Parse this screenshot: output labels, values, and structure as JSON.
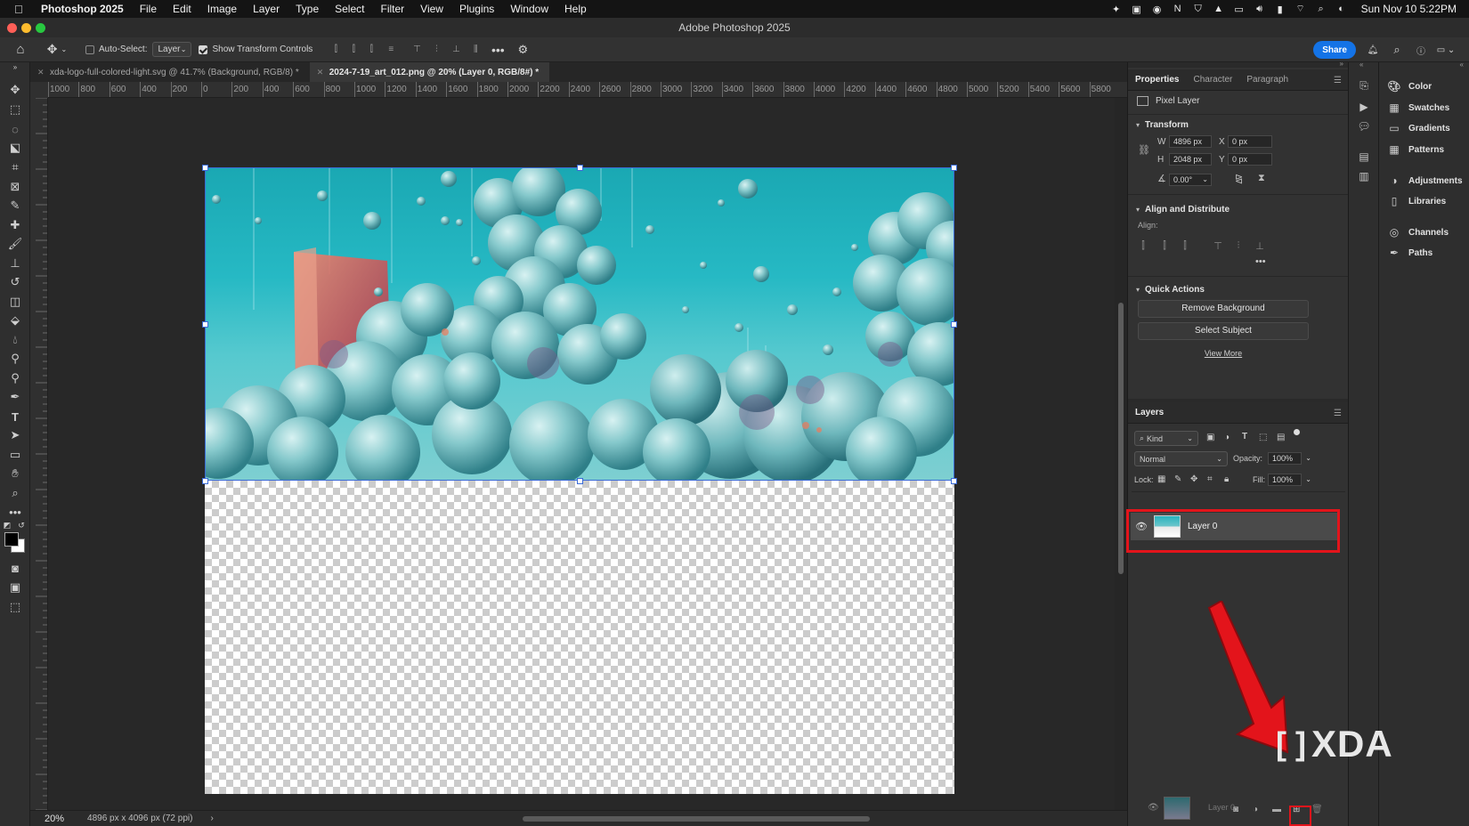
{
  "menubar": {
    "app_name": "Photoshop 2025",
    "menus": [
      "File",
      "Edit",
      "Image",
      "Layer",
      "Type",
      "Select",
      "Filter",
      "View",
      "Plugins",
      "Window",
      "Help"
    ],
    "clock": "Sun Nov 10  5:22PM"
  },
  "window": {
    "title": "Adobe Photoshop 2025"
  },
  "options_bar": {
    "auto_select_label": "Auto-Select:",
    "auto_select_value": "Layer",
    "show_transform_label": "Show Transform Controls",
    "share_label": "Share"
  },
  "tabs": [
    {
      "label": "xda-logo-full-colored-light.svg @ 41.7% (Background, RGB/8) *",
      "active": false
    },
    {
      "label": "2024-7-19_art_012.png @ 20% (Layer 0, RGB/8#) *",
      "active": true
    }
  ],
  "ruler": {
    "h_labels": [
      "1000",
      "800",
      "600",
      "400",
      "200",
      "0",
      "200",
      "400",
      "600",
      "800",
      "1000",
      "1200",
      "1400",
      "1600",
      "1800",
      "2000",
      "2200",
      "2400",
      "2600",
      "2800",
      "3000",
      "3200",
      "3400",
      "3600",
      "3800",
      "4000",
      "4200",
      "4400",
      "4600",
      "4800",
      "5000",
      "5200",
      "5400",
      "5600",
      "5800"
    ]
  },
  "status_bar": {
    "zoom": "20%",
    "doc_info": "4896 px x 4096 px (72 ppi)"
  },
  "properties": {
    "tabs": [
      "Properties",
      "Character",
      "Paragraph"
    ],
    "layer_kind": "Pixel Layer",
    "transform_title": "Transform",
    "w_label": "W",
    "w_value": "4896 px",
    "h_label": "H",
    "h_value": "2048 px",
    "x_label": "X",
    "x_value": "0 px",
    "y_label": "Y",
    "y_value": "0 px",
    "angle_value": "0.00°",
    "align_title": "Align and Distribute",
    "align_label": "Align:",
    "quick_actions_title": "Quick Actions",
    "remove_bg_label": "Remove Background",
    "select_subject_label": "Select Subject",
    "view_more_label": "View More"
  },
  "layers": {
    "title": "Layers",
    "filter_kind": "Kind",
    "blend_mode": "Normal",
    "opacity_label": "Opacity:",
    "opacity_value": "100%",
    "lock_label": "Lock:",
    "fill_label": "Fill:",
    "fill_value": "100%",
    "layer_name": "Layer 0",
    "ghost_layer_name": "Layer 0"
  },
  "right_panel_items": [
    "Color",
    "Swatches",
    "Gradients",
    "Patterns",
    "Adjustments",
    "Libraries",
    "Channels",
    "Paths"
  ],
  "watermark": "XDA",
  "colors": {
    "accent": "#1473e6",
    "annotation_red": "#e3141b",
    "panel_bg": "#323232"
  }
}
